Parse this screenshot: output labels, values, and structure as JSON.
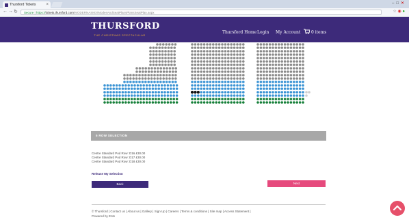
{
  "browser": {
    "tab_title": "Thursford Tickets",
    "tab_close": "×",
    "url_secure": "Secure",
    "url_scheme": "https://",
    "url_domain": "tickets.thursford.com",
    "url_path": "/MODERNASMX/ModesAndSeatPlansPlansSeatPlan.aspx"
  },
  "header": {
    "logo_text": "THURSFORD",
    "logo_sub": "THE CHRISTMAS SPECTACULAR",
    "nav": {
      "home": "Thursford Home",
      "login": "Login",
      "account": "My Account",
      "basket": "0 items"
    },
    "colors": {
      "header_bg": "#3d2a7a",
      "accent": "#e64a7d"
    }
  },
  "seat_map": {
    "colors": {
      "unavailable": "#8a8a8a",
      "available": "#3a93d4",
      "restricted": "#17803a",
      "selected": "#111111",
      "empty": "#cfcfcf"
    },
    "selected_seats_shown": 3
  },
  "selection": {
    "title": "5 ROW SELECTION",
    "seats": [
      "Centre Standard Pod Row: D16 £30.00",
      "Centre Standard Pod Row: D17 £30.00",
      "Centre Standard Pod Row: D18 £30.00"
    ],
    "release_label": "Release My Selection",
    "back_label": "Back",
    "next_label": "Next"
  },
  "footer": {
    "links_text": "© Thursford  |  Contact us  |  About us  |  Gallery  |  Sign Up  |  Careers  |  Terms & conditions  |  Site map  |  Access Statement  |",
    "powered_by": "Powered by Ents"
  },
  "icons": {
    "back": "back-arrow-icon",
    "forward": "forward-arrow-icon",
    "reload": "reload-icon",
    "basket": "basket-icon",
    "scroll_top": "chevron-up-icon"
  }
}
